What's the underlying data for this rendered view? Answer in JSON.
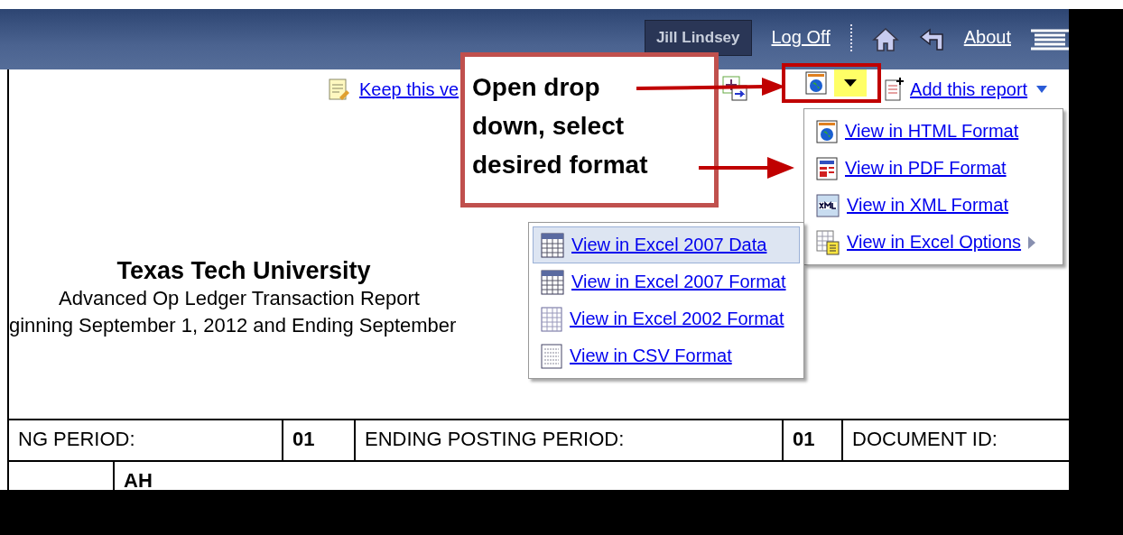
{
  "header": {
    "user": "Jill Lindsey",
    "logoff": "Log Off",
    "about": "About"
  },
  "toolbar": {
    "keep_link": "Keep this ve",
    "add_link": "Add this report"
  },
  "callout": {
    "lines": [
      "Open drop",
      "down, select",
      "desired format"
    ]
  },
  "format_menu": [
    {
      "kind": "html",
      "label": "View in HTML Format",
      "submenu": false
    },
    {
      "kind": "pdf",
      "label": "View in PDF Format",
      "submenu": false
    },
    {
      "kind": "xml",
      "label": "View in XML Format",
      "submenu": false
    },
    {
      "kind": "excel-options",
      "label": "View in Excel Options",
      "submenu": true
    }
  ],
  "excel_menu": [
    {
      "kind": "excel2007",
      "label": "View in Excel 2007 Data",
      "selected": true
    },
    {
      "kind": "excel2007",
      "label": "View in Excel 2007 Format",
      "selected": false
    },
    {
      "kind": "excel2002",
      "label": "View in Excel 2002 Format",
      "selected": false
    },
    {
      "kind": "csv",
      "label": "View in CSV Format",
      "selected": false
    }
  ],
  "report": {
    "title": "Texas Tech University",
    "subtitle": "Advanced Op Ledger Transaction Report",
    "period_line": "ginning September 1, 2012 and Ending September"
  },
  "table": {
    "row_1": [
      {
        "kind": "label",
        "text": "NG PERIOD:"
      },
      {
        "kind": "value",
        "text": "01"
      },
      {
        "kind": "label",
        "text": "ENDING POSTING PERIOD:"
      },
      {
        "kind": "value",
        "text": "01"
      },
      {
        "kind": "label",
        "text": "DOCUMENT ID:"
      }
    ],
    "row_2": [
      {
        "kind": "empty"
      },
      {
        "kind": "value",
        "text": "AH"
      }
    ]
  }
}
